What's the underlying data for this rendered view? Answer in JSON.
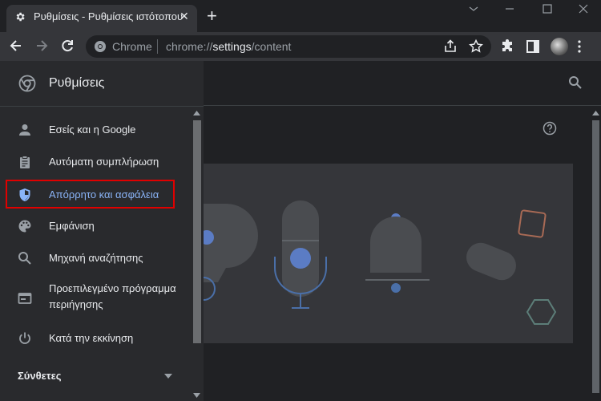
{
  "browser": {
    "tab_title": "Ρυθμίσεις - Ρυθμίσεις ιστότοπου",
    "tab_close": "✕",
    "new_tab": "+",
    "omnibox_site": "Chrome",
    "url_prefix": "chrome://",
    "url_host": "settings",
    "url_path": "/content"
  },
  "settings": {
    "title": "Ρυθμίσεις",
    "sidebar": {
      "items": [
        {
          "label": "Εσείς και η Google",
          "icon": "person-icon"
        },
        {
          "label": "Αυτόματη συμπλήρωση",
          "icon": "clipboard-icon"
        },
        {
          "label": "Απόρρητο και ασφάλεια",
          "icon": "shield-icon",
          "active": true
        },
        {
          "label": "Εμφάνιση",
          "icon": "palette-icon"
        },
        {
          "label": "Μηχανή αναζήτησης",
          "icon": "search-icon"
        },
        {
          "label": "Προεπιλεγμένο πρόγραμμα",
          "label2": "περιήγησης",
          "icon": "browser-window-icon"
        },
        {
          "label": "Κατά την εκκίνηση",
          "icon": "power-icon"
        }
      ],
      "advanced": "Σύνθετες"
    }
  },
  "colors": {
    "accent": "#8ab4f8",
    "highlight": "#e00000"
  }
}
